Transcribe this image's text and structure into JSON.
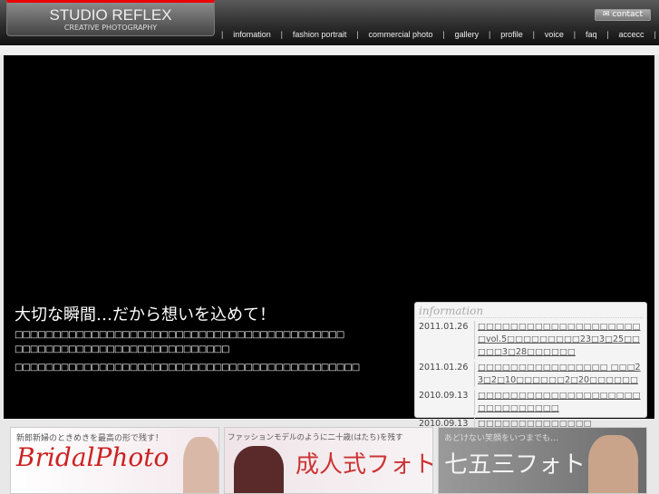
{
  "header": {
    "logo_title": "STUDIO REFLEX",
    "logo_subtitle": "CREATIVE PHOTOGRAPHY",
    "contact_label": "contact",
    "contact_icon": "envelope-icon",
    "nav": [
      "infomation",
      "fashion portrait",
      "commercial photo",
      "gallery",
      "profile",
      "voice",
      "faq",
      "accecc"
    ]
  },
  "main": {
    "headline": "大切な瞬間…だから想いを込めて！",
    "lines": [
      "□□□□□□□□□□□□□□□□□□□□□□□□□□□□□□□□□□□□□□□□□□□",
      "□□□□□□□□□□□□□□□□□□□□□□□□□□□□",
      "□□□□□□□□□□□□□□□□□□□□□□□□□□□□□□□□□□□□□□□□□□□□□"
    ]
  },
  "info": {
    "title": "information",
    "items": [
      {
        "date": "2011.01.26",
        "text": "□□□□□□□□□□□□□□□□□□□□□vol.5□□□□□□□□□23□3□25□□□□□3□28□□□□□□"
      },
      {
        "date": "2011.01.26",
        "text": "□□□□□□□□□□□□□□□□ □□□23□2□10□□□□□□2□20□□□□□□"
      },
      {
        "date": "2010.09.13",
        "text": "□□□□□□□□□□□□□□□□□□□□□□□□□□□□□□"
      },
      {
        "date": "2010.09.13",
        "text": "□□□□□□□□□□□□□□"
      }
    ]
  },
  "banners": [
    {
      "caption": "新郎新婦のときめきを最高の形で残す！",
      "title": "BridalPhoto"
    },
    {
      "caption": "ファッションモデルのように二十歳(はたち)を残す",
      "title": "成人式フォト"
    },
    {
      "caption": "あどけない笑顔をいつまでも…",
      "title": "七五三フォト"
    }
  ]
}
